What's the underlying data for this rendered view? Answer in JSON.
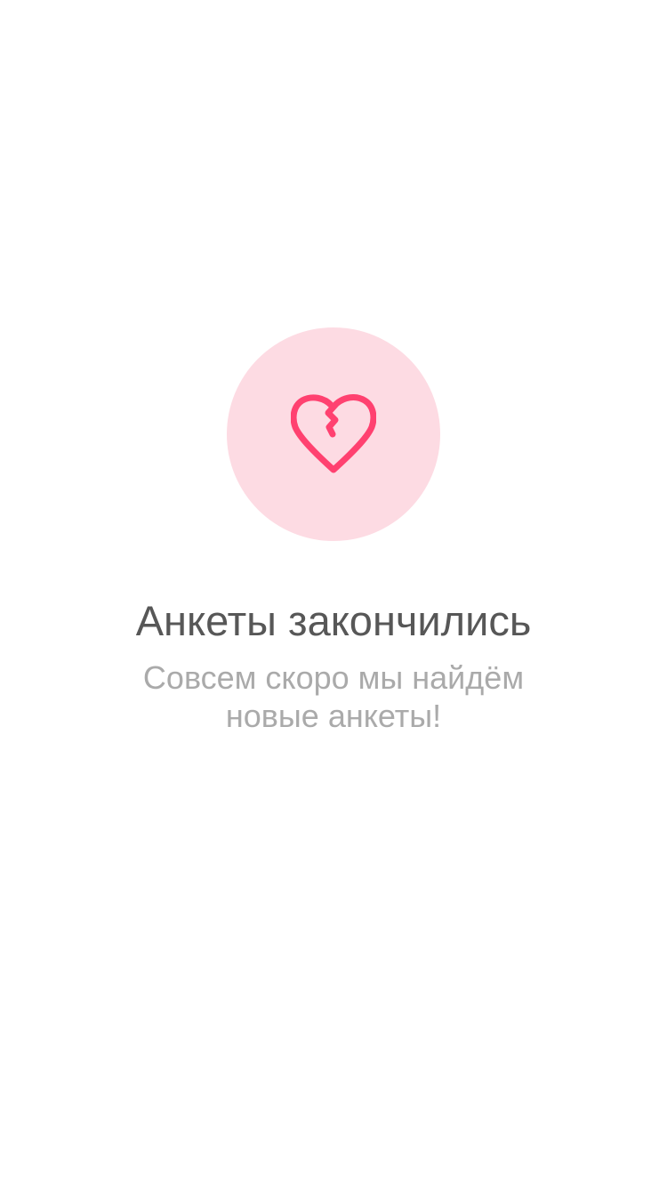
{
  "empty_state": {
    "icon": "broken-heart-icon",
    "title": "Анкеты закончились",
    "subtitle": "Совсем скоро мы найдём новые анкеты!"
  },
  "colors": {
    "background": "#ffffff",
    "icon_circle": "#fddbe3",
    "icon_stroke": "#ff4170",
    "title": "#575757",
    "subtitle": "#aaaaaa"
  }
}
